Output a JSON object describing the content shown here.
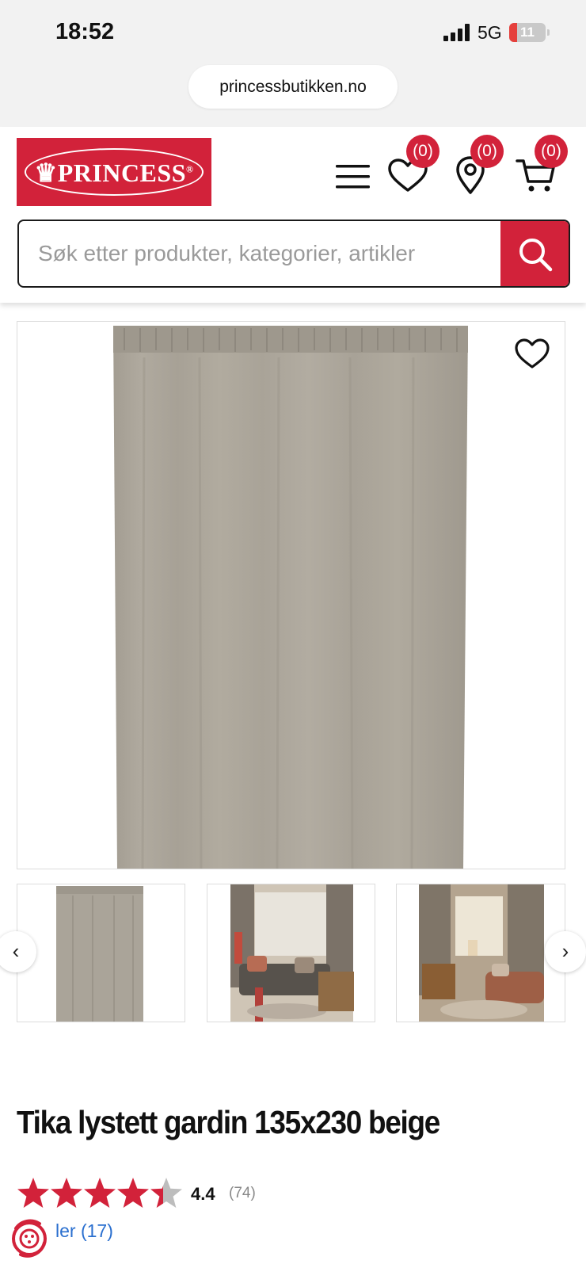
{
  "status_bar": {
    "time": "18:52",
    "network": "5G",
    "battery": "11",
    "battery_level_percent": 11
  },
  "browser": {
    "url": "princessbutikken.no"
  },
  "header": {
    "logo_text": "PRINCESS",
    "logo_mark": "®",
    "icons": [
      "menu-icon",
      "heart-icon",
      "location-icon",
      "cart-icon"
    ],
    "favorites_count": "(0)",
    "stores_count": "(0)",
    "cart_count": "(0)",
    "search_placeholder": "Søk etter produkter, kategorier, artikler"
  },
  "gallery": {
    "prev_label": "‹",
    "next_label": "›",
    "thumbnail_count": 3
  },
  "product": {
    "title": "Tika lystett gardin 135x230 beige",
    "rating": "4.4",
    "rating_value": 4.4,
    "rating_max": 5,
    "review_count": "(74)",
    "reviews_link": "ler (17)"
  },
  "colors": {
    "brand_red": "#d2223a",
    "link_blue": "#2a6fcf",
    "star_grey": "#bdbdbd",
    "curtain_beige": "#a9a398"
  }
}
